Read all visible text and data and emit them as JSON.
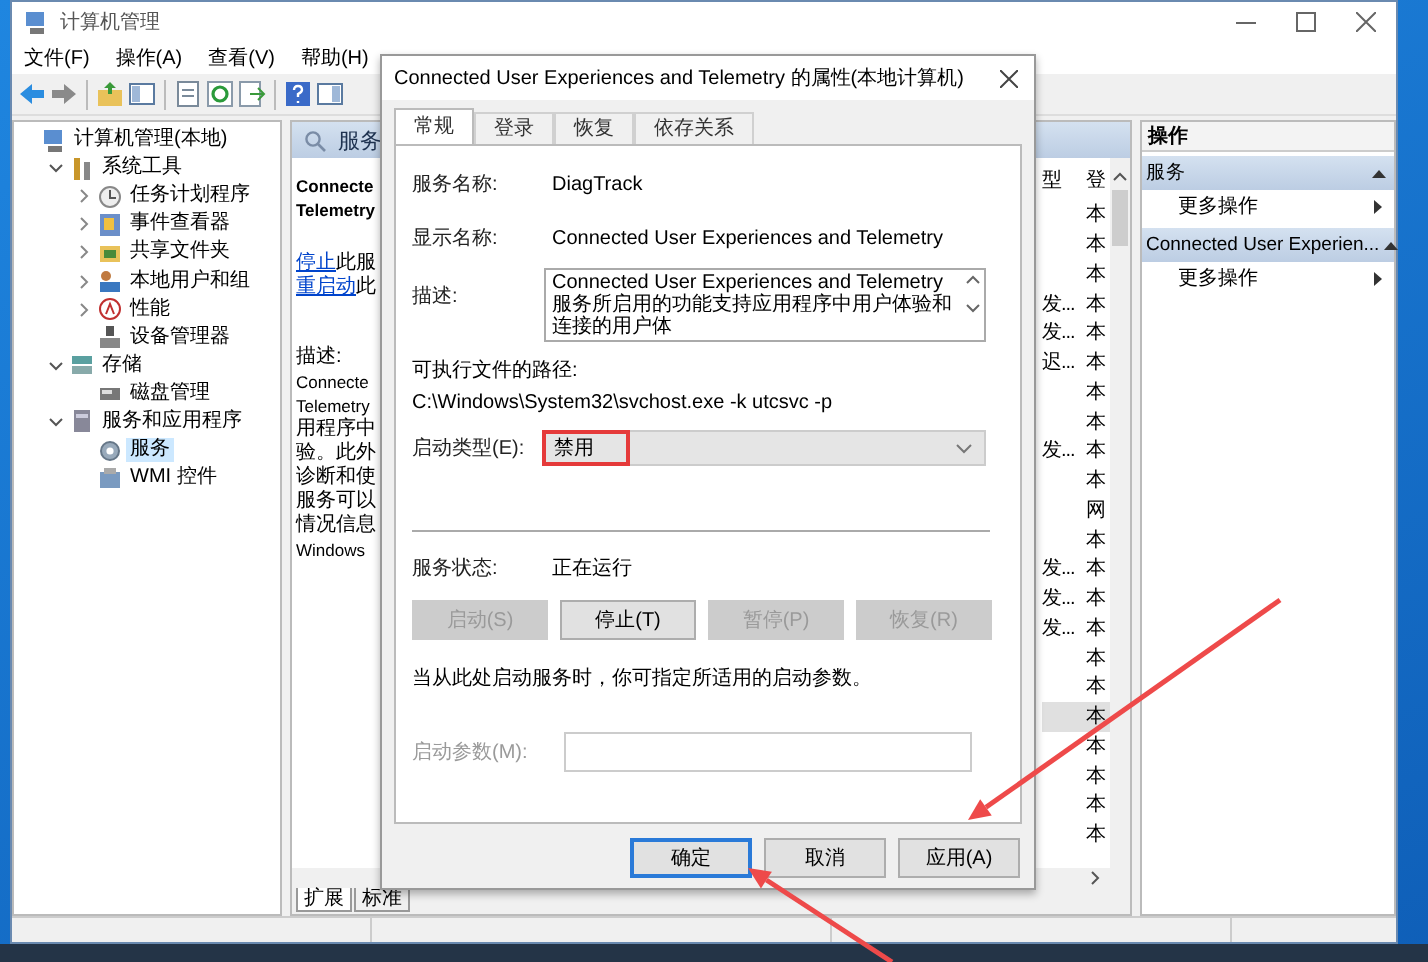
{
  "window": {
    "title": "计算机管理"
  },
  "menu": [
    "文件(F)",
    "操作(A)",
    "查看(V)",
    "帮助(H)"
  ],
  "tree": [
    {
      "label": "计算机管理(本地)",
      "selected": false,
      "children": [
        {
          "label": "系统工具",
          "expanded": true,
          "selected": false,
          "children": [
            {
              "label": "任务计划程序",
              "expanded": false,
              "selected": false
            },
            {
              "label": "事件查看器",
              "expanded": false,
              "selected": false
            },
            {
              "label": "共享文件夹",
              "expanded": false,
              "selected": false
            },
            {
              "label": "本地用户和组",
              "expanded": false,
              "selected": false
            },
            {
              "label": "性能",
              "expanded": false,
              "selected": false
            },
            {
              "label": "设备管理器",
              "selected": false
            }
          ]
        },
        {
          "label": "存储",
          "expanded": true,
          "selected": false,
          "children": [
            {
              "label": "磁盘管理",
              "selected": false
            }
          ]
        },
        {
          "label": "服务和应用程序",
          "expanded": true,
          "selected": false,
          "children": [
            {
              "label": "服务",
              "selected": true
            },
            {
              "label": "WMI 控件",
              "selected": false
            }
          ]
        }
      ]
    }
  ],
  "services_pane": {
    "title": "服务",
    "service_name": [
      "Connecte",
      "Telemetry"
    ],
    "actions": [
      {
        "link": "停止",
        "text": "此服"
      },
      {
        "link": "重启动",
        "text": "此"
      }
    ],
    "description_label": "描述:",
    "description_lines": [
      "Connecte",
      "Telemetry",
      "用程序中",
      "验。此外",
      "诊断和使",
      "服务可以",
      "情况信息",
      "Windows"
    ],
    "columns": [
      "型",
      "登"
    ],
    "rows": [
      {
        "column_2": "本",
        "selected": false
      },
      {
        "column_2": "本",
        "selected": false
      },
      {
        "column_2": "本",
        "selected": false
      },
      {
        "column_1": "发...",
        "column_2": "本",
        "selected": false
      },
      {
        "column_1": "发...",
        "column_2": "本",
        "selected": false
      },
      {
        "column_1": "迟...",
        "column_2": "本",
        "selected": false
      },
      {
        "column_2": "本",
        "selected": false
      },
      {
        "column_2": "本",
        "selected": false
      },
      {
        "column_1": "发...",
        "column_2": "本",
        "selected": false
      },
      {
        "column_2": "本",
        "selected": false
      },
      {
        "column_2": "网",
        "selected": false
      },
      {
        "column_2": "本",
        "selected": false
      },
      {
        "column_1": "发...",
        "column_2": "本",
        "selected": false
      },
      {
        "column_1": "发...",
        "column_2": "本",
        "selected": false
      },
      {
        "column_1": "发...",
        "column_2": "本",
        "selected": false
      },
      {
        "column_2": "本",
        "selected": false
      },
      {
        "column_2": "本",
        "selected": false
      },
      {
        "column_2": "本",
        "selected": true
      },
      {
        "column_2": "本",
        "selected": false
      },
      {
        "column_2": "本",
        "selected": false
      },
      {
        "column_2": "本",
        "selected": false
      },
      {
        "column_2": "本",
        "selected": false
      }
    ],
    "tabs": [
      {
        "label": "扩展",
        "selected": true
      },
      {
        "label": "标准",
        "selected": false
      }
    ]
  },
  "actions_pane": {
    "title": "操作",
    "sections": [
      {
        "title": "服务",
        "items": [
          "更多操作"
        ]
      },
      {
        "title": "Connected User Experien...",
        "items": [
          "更多操作"
        ]
      }
    ]
  },
  "dialog": {
    "title": "Connected User Experiences and Telemetry 的属性(本地计算机)",
    "tabs": [
      {
        "label": "常规",
        "selected": true
      },
      {
        "label": "登录",
        "selected": false
      },
      {
        "label": "恢复",
        "selected": false
      },
      {
        "label": "依存关系",
        "selected": false
      }
    ],
    "service_name": {
      "label": "服务名称:",
      "value": "DiagTrack"
    },
    "display_name": {
      "label": "显示名称:",
      "value": "Connected User Experiences and Telemetry"
    },
    "description": {
      "label": "描述:",
      "value": "Connected User Experiences and Telemetry 服务所启用的功能支持应用程序中用户体验和连接的用户体"
    },
    "path": {
      "label": "可执行文件的路径:",
      "value": "C:\\Windows\\System32\\svchost.exe -k utcsvc -p"
    },
    "startup_type": {
      "label": "启动类型(E):",
      "value": "禁用",
      "highlighted": true
    },
    "status": {
      "label": "服务状态:",
      "value": "正在运行"
    },
    "service_buttons": [
      {
        "label": "启动(S)",
        "disabled": true
      },
      {
        "label": "停止(T)",
        "disabled": false
      },
      {
        "label": "暂停(P)",
        "disabled": true
      },
      {
        "label": "恢复(R)",
        "disabled": true
      }
    ],
    "note": "当从此处启动服务时，你可指定所适用的启动参数。",
    "start_params": {
      "label": "启动参数(M):",
      "disabled": true
    },
    "buttons": [
      {
        "label": "确定",
        "default": true
      },
      {
        "label": "取消",
        "default": false
      },
      {
        "label": "应用(A)",
        "default": false
      }
    ]
  },
  "annotations": [
    {
      "kind": "arrow"
    },
    {
      "kind": "arrow"
    }
  ]
}
